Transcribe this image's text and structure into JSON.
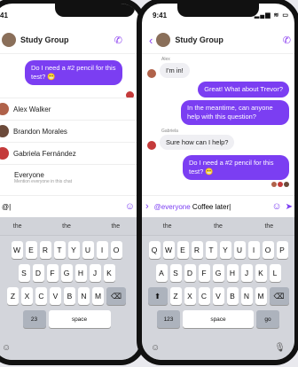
{
  "left": {
    "time": "41",
    "group": "Study Group",
    "msg_out": "Do I need a #2 pencil for this test? 😬",
    "mentions": [
      {
        "name": "Alex Walker",
        "color": "#b0624a"
      },
      {
        "name": "Brandon Morales",
        "color": "#6c4a3a"
      },
      {
        "name": "Gabriela Fernández",
        "color": "#c43a3a"
      },
      {
        "name": "Everyone",
        "sub": "Mention everyone in this chat",
        "color": "#ffffff"
      }
    ],
    "input_value": "@|",
    "suggestions": [
      "the",
      "the",
      "the"
    ],
    "row1": [
      "W",
      "E",
      "R",
      "T",
      "Y",
      "U",
      "I",
      "O"
    ],
    "row2": [
      "S",
      "D",
      "F",
      "G",
      "H",
      "J",
      "K"
    ],
    "row3": [
      "Z",
      "X",
      "C",
      "V",
      "B",
      "N",
      "M"
    ],
    "num_key": "23",
    "space_key": "space"
  },
  "right": {
    "time": "9:41",
    "signal": "▂▄▆ ≋ ▭",
    "group": "Study Group",
    "messages": [
      {
        "type": "in",
        "sender": "Alex",
        "text": "I'm in!"
      },
      {
        "type": "out",
        "text": "Great! What about Trevor?"
      },
      {
        "type": "out",
        "text": "In the meantime, can anyone help with this question?"
      },
      {
        "type": "in",
        "sender": "Gabriela",
        "text": "Sure how can I help?"
      },
      {
        "type": "out",
        "text": "Do I need a #2 pencil for this test? 😬"
      }
    ],
    "input_mention": "@everyone",
    "input_text": " Coffee later|",
    "suggestions": [
      "the",
      "the",
      "the"
    ],
    "row1": [
      "Q",
      "W",
      "E",
      "R",
      "T",
      "Y",
      "U",
      "I",
      "O",
      "P"
    ],
    "row2": [
      "A",
      "S",
      "D",
      "F",
      "G",
      "H",
      "J",
      "K",
      "L"
    ],
    "row3": [
      "Z",
      "X",
      "C",
      "V",
      "B",
      "N",
      "M"
    ],
    "num_key": "123",
    "space_key": "space",
    "go_key": "go"
  },
  "colors": {
    "accent": "#7b3ef2"
  }
}
